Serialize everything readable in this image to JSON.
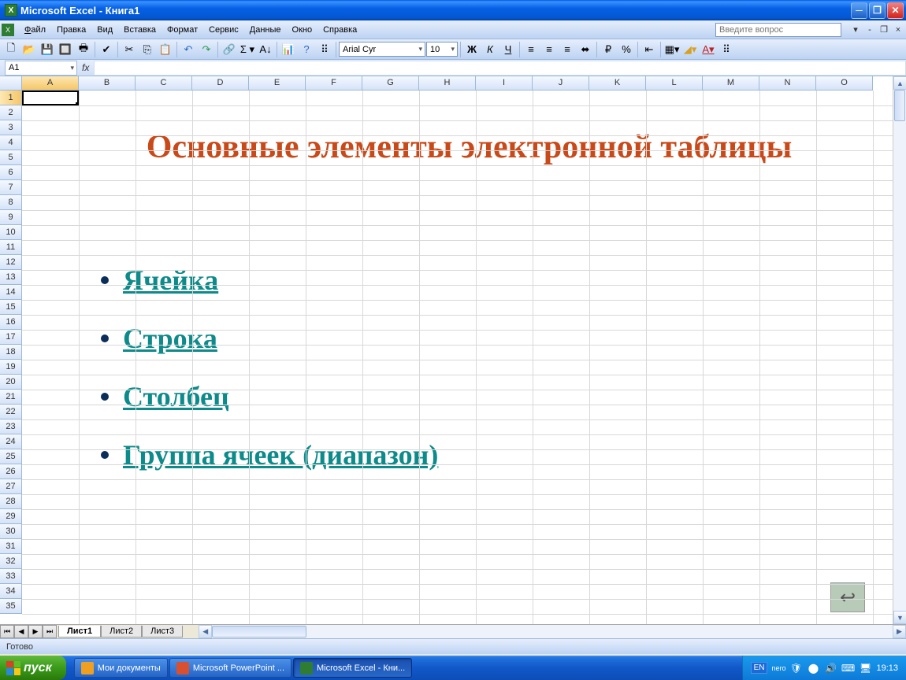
{
  "titlebar": {
    "appname": "Microsoft Excel",
    "docname": "Книга1"
  },
  "menu": {
    "file": "Файл",
    "edit": "Правка",
    "view": "Вид",
    "insert": "Вставка",
    "format": "Формат",
    "tools": "Сервис",
    "data": "Данные",
    "window": "Окно",
    "help": "Справка",
    "question_placeholder": "Введите вопрос"
  },
  "toolbar": {
    "font": "Arial Cyr",
    "size": "10",
    "bold": "Ж",
    "italic": "К",
    "underline": "Ч"
  },
  "namebox": {
    "ref": "A1"
  },
  "columns": [
    "A",
    "B",
    "C",
    "D",
    "E",
    "F",
    "G",
    "H",
    "I",
    "J",
    "K",
    "L",
    "M",
    "N",
    "O"
  ],
  "rows": [
    "1",
    "2",
    "3",
    "4",
    "5",
    "6",
    "7",
    "8",
    "9",
    "10",
    "11",
    "12",
    "13",
    "14",
    "15",
    "16",
    "17",
    "18",
    "19",
    "20",
    "21",
    "22",
    "23",
    "24",
    "25",
    "26",
    "27",
    "28",
    "29",
    "30",
    "31",
    "32",
    "33",
    "34",
    "35"
  ],
  "content": {
    "title": "Основные элементы электронной таблицы",
    "bullets": [
      "Ячейка",
      "Строка",
      "Столбец",
      "Группа ячеек (диапазон)"
    ]
  },
  "sheets": {
    "s1": "Лист1",
    "s2": "Лист2",
    "s3": "Лист3"
  },
  "status": {
    "ready": "Готово"
  },
  "taskbar": {
    "start": "пуск",
    "b1": "Мои документы",
    "b2": "Microsoft PowerPoint ...",
    "b3": "Microsoft Excel - Кни...",
    "lang": "EN",
    "nero": "nero",
    "clock": "19:13"
  }
}
